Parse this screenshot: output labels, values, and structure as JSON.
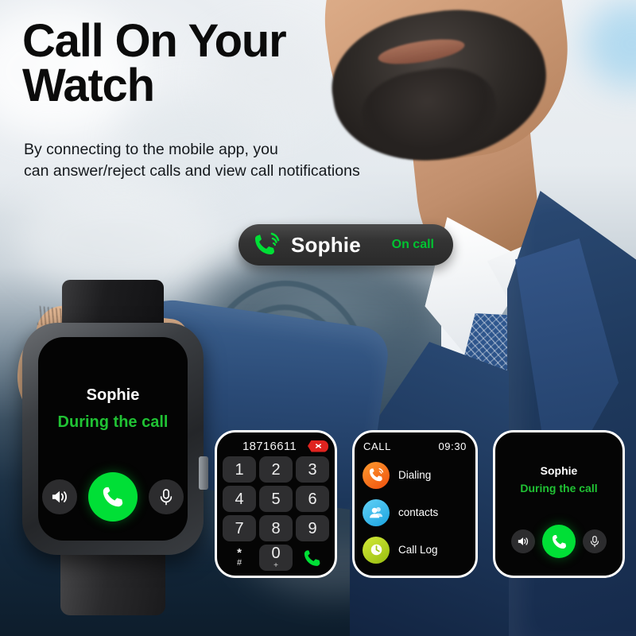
{
  "headline": "Call On Your Watch",
  "subhead_line1": "By connecting to the mobile app, you",
  "subhead_line2": "can answer/reject calls and view call notifications",
  "colors": {
    "accent_green": "#00df36",
    "status_green": "#20c234",
    "pill_green": "#00c331",
    "delete_red": "#e0231f",
    "dialing_orange": "#f36a1a",
    "contacts_blue": "#2fb6ef",
    "calllog_lime": "#b4d424",
    "background_navy": "#0d1d2c"
  },
  "notification": {
    "icon": "phone-ringing-icon",
    "caller": "Sophie",
    "status": "On call"
  },
  "watch_main": {
    "caller": "Sophie",
    "status": "During the call",
    "controls": [
      {
        "name": "speaker-button",
        "icon": "speaker-icon"
      },
      {
        "name": "answer-call-button",
        "icon": "phone-icon"
      },
      {
        "name": "mute-button",
        "icon": "microphone-icon"
      }
    ]
  },
  "dialer_panel": {
    "number": "18716611",
    "delete_icon": "backspace-delete-icon",
    "keys": [
      {
        "main": "1",
        "sub": ""
      },
      {
        "main": "2",
        "sub": ""
      },
      {
        "main": "3",
        "sub": ""
      },
      {
        "main": "4",
        "sub": ""
      },
      {
        "main": "5",
        "sub": ""
      },
      {
        "main": "6",
        "sub": ""
      },
      {
        "main": "7",
        "sub": ""
      },
      {
        "main": "8",
        "sub": ""
      },
      {
        "main": "9",
        "sub": ""
      }
    ],
    "key_star": "*",
    "key_hash": "#",
    "key_zero": "0",
    "key_zero_sub": "+",
    "key_call_icon": "phone-icon"
  },
  "menu_panel": {
    "title": "CALL",
    "time": "09:30",
    "items": [
      {
        "label": "Dialing",
        "icon": "phone-ringing-icon",
        "color": "#f36a1a"
      },
      {
        "label": "contacts",
        "icon": "contacts-people-icon",
        "color": "#2fb6ef"
      },
      {
        "label": "Call Log",
        "icon": "clock-icon",
        "color": "#b4d424"
      }
    ]
  },
  "call_panel": {
    "caller": "Sophie",
    "status": "During the call",
    "controls": [
      {
        "name": "speaker-button",
        "icon": "speaker-icon"
      },
      {
        "name": "answer-call-button",
        "icon": "phone-icon"
      },
      {
        "name": "mute-button",
        "icon": "microphone-icon"
      }
    ]
  }
}
